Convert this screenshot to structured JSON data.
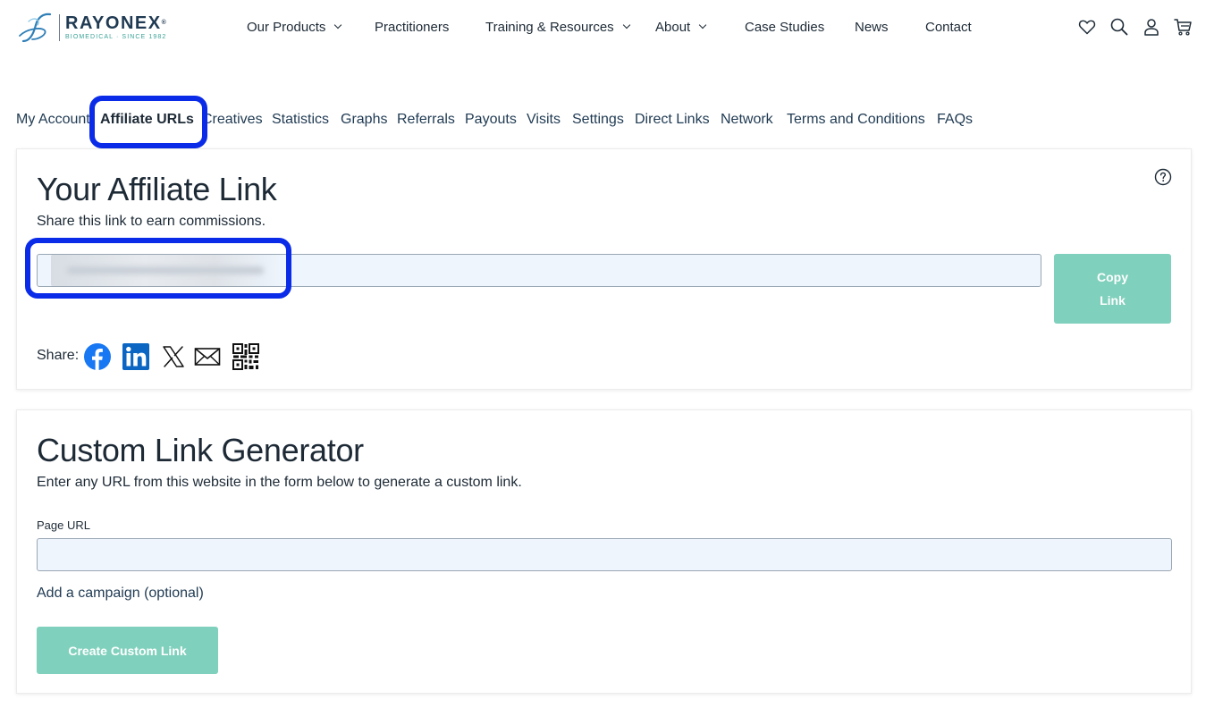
{
  "brand": {
    "name": "RAYONEX",
    "tagline": "BIOMEDICAL · SINCE 1982",
    "trademark": "®"
  },
  "topnav": {
    "items": [
      {
        "label": "Our Products",
        "has_dropdown": true
      },
      {
        "label": "Practitioners",
        "has_dropdown": false
      },
      {
        "label": "Training & Resources",
        "has_dropdown": true
      },
      {
        "label": "About",
        "has_dropdown": true
      },
      {
        "label": "Case Studies",
        "has_dropdown": false
      },
      {
        "label": "News",
        "has_dropdown": false
      },
      {
        "label": "Contact",
        "has_dropdown": false
      }
    ],
    "icons": [
      "heart-icon",
      "search-icon",
      "user-icon",
      "cart-icon"
    ]
  },
  "tabs": {
    "items": [
      {
        "label": "My Account"
      },
      {
        "label": "Affiliate URLs",
        "active": true
      },
      {
        "label": "Creatives"
      },
      {
        "label": "Statistics"
      },
      {
        "label": "Graphs"
      },
      {
        "label": "Referrals"
      },
      {
        "label": "Payouts"
      },
      {
        "label": "Visits"
      },
      {
        "label": "Settings"
      },
      {
        "label": "Direct Links"
      },
      {
        "label": "Network"
      },
      {
        "label": "Terms and Conditions"
      },
      {
        "label": "FAQs"
      }
    ]
  },
  "affiliate_link": {
    "title": "Your Affiliate Link",
    "description": "Share this link to earn commissions.",
    "link_value": "",
    "copy_button": "Copy Link",
    "share_label": "Share:",
    "share_icons": [
      "facebook-icon",
      "linkedin-icon",
      "x-icon",
      "email-icon",
      "qr-code-icon"
    ]
  },
  "custom_link": {
    "title": "Custom Link Generator",
    "description": "Enter any URL from this website in the form below to generate a custom link.",
    "page_url_label": "Page URL",
    "page_url_value": "",
    "campaign_link": "Add a campaign (optional)",
    "create_button": "Create Custom Link"
  },
  "colors": {
    "brand_navy": "#1f3a52",
    "brand_teal": "#3aa296",
    "button_mint": "#7fd0bc",
    "input_bg": "#eef5fd",
    "highlight": "#0a2be8"
  }
}
